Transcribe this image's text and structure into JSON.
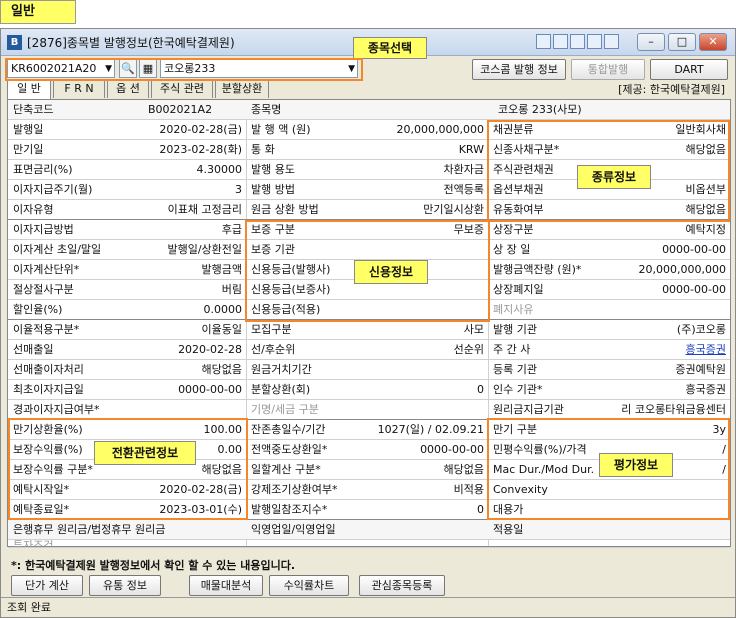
{
  "tag_label": "일반",
  "window": {
    "title": "[2876]종목별 발행정보(한국예탁결제원)",
    "app_icon": "B",
    "min": "–",
    "max": "□",
    "close": "✕"
  },
  "controls": {
    "code_value": "KR6002021A20",
    "search_icon": "🔍",
    "name_value": "코오롱233",
    "buttons": {
      "kosdaq": "코스콤 발행 정보",
      "integrated": "통합발행",
      "dart": "DART"
    }
  },
  "tabs": [
    {
      "label": "일 반",
      "active": true
    },
    {
      "label": "F R N"
    },
    {
      "label": "옵 션"
    },
    {
      "label": "주식 관련"
    },
    {
      "label": "분할상환"
    }
  ],
  "provider": "[제공: 한국예탁결제원]",
  "header_row": {
    "l1": "단축코드",
    "v1": "B002021A2",
    "l2": "종목명",
    "v2": "코오롱 233(사모)"
  },
  "section1": {
    "left": [
      [
        "발행일",
        "2020-02-28(금)"
      ],
      [
        "만기일",
        "2023-02-28(화)"
      ],
      [
        "표면금리(%)",
        "4.30000"
      ],
      [
        "이자지급주기(월)",
        "3"
      ],
      [
        "이자유형",
        "이표채 고정금리"
      ]
    ],
    "mid": [
      [
        "발 행 액 (원)",
        "20,000,000,000"
      ],
      [
        "통 화",
        "KRW"
      ],
      [
        "발행 용도",
        "차환자금"
      ],
      [
        "발행 방법",
        "전액등록"
      ],
      [
        "원금 상환 방법",
        "만기일시상환"
      ]
    ],
    "right": [
      [
        "채권분류",
        "일반회사채"
      ],
      [
        "신종사채구분*",
        "해당없음"
      ],
      [
        "주식관련채권",
        ""
      ],
      [
        "옵션부채권",
        "비옵션부"
      ],
      [
        "유동화여부",
        "해당없음"
      ]
    ]
  },
  "section2": {
    "left": [
      [
        "이자지급방법",
        "후급"
      ],
      [
        "이자계산 초일/말일",
        "발행일/상환전일"
      ],
      [
        "이자계산단위*",
        "발행금액"
      ],
      [
        "절상절사구분",
        "버림"
      ],
      [
        "할인율(%)",
        "0.0000"
      ]
    ],
    "mid": [
      [
        "보증 구분",
        "무보증"
      ],
      [
        "보증 기관",
        ""
      ],
      [
        "신용등급(발행사)",
        ""
      ],
      [
        "신용등급(보증사)",
        ""
      ],
      [
        "신용등급(적용)",
        ""
      ]
    ],
    "right": [
      [
        "상장구분",
        "예탁지정"
      ],
      [
        "상 장 일",
        "0000-00-00"
      ],
      [
        "발행금액잔량 (원)*",
        "20,000,000,000"
      ],
      [
        "상장폐지일",
        "0000-00-00"
      ],
      [
        "폐지사유",
        ""
      ]
    ]
  },
  "section3": {
    "left": [
      [
        "이율적용구분*",
        "이율동일"
      ],
      [
        "선매출일",
        "2020-02-28"
      ],
      [
        "선매출이자처리",
        "해당없음"
      ],
      [
        "최초이자지급일",
        "0000-00-00"
      ],
      [
        "경과이자지급여부*",
        ""
      ]
    ],
    "mid": [
      [
        "모집구분",
        "사모"
      ],
      [
        "선/후순위",
        "선순위"
      ],
      [
        "원금거치기간",
        ""
      ],
      [
        "분할상환(회)",
        "0"
      ],
      [
        "기명/세금 구분",
        ""
      ]
    ],
    "right": [
      [
        "발행 기관",
        "(주)코오롱"
      ],
      [
        "주 간 사",
        "흥국증권"
      ],
      [
        "등록 기관",
        "증권예탁원"
      ],
      [
        "인수 기관*",
        "흥국증권"
      ],
      [
        "원리금지급기관",
        "리 코오롱타워금융센터"
      ]
    ]
  },
  "section4": {
    "left": [
      [
        "만기상환율(%)",
        "100.00"
      ],
      [
        "보장수익률(%)",
        "0.00"
      ],
      [
        "보장수익률 구분*",
        "해당없음"
      ],
      [
        "예탁시작일*",
        "2020-02-28(금)"
      ],
      [
        "예탁종료일*",
        "2023-03-01(수)"
      ]
    ],
    "mid": [
      [
        "잔존총일수/기간",
        "1027(일) / 02.09.21"
      ],
      [
        "전액중도상환일*",
        "0000-00-00"
      ],
      [
        "일할계산 구분*",
        "해당없음"
      ],
      [
        "강제조기상환여부*",
        "비적용"
      ],
      [
        "발행일참조지수*",
        "0"
      ]
    ],
    "right": [
      [
        "만기 구분",
        "3y"
      ],
      [
        "민평수익률(%)/가격",
        "/"
      ],
      [
        "Mac Dur./Mod Dur.",
        "/"
      ],
      [
        "Convexity",
        ""
      ],
      [
        "대용가",
        ""
      ]
    ]
  },
  "bottom_rows": [
    [
      "은행휴무 원리금/법정휴무 원리금",
      "익영업일/익영업일",
      "적용일",
      ""
    ],
    [
      "투자조건",
      "",
      "",
      ""
    ]
  ],
  "callouts": {
    "select": "종목선택",
    "type": "종류정보",
    "credit": "신용정보",
    "convert": "전환관련정보",
    "eval": "평가정보"
  },
  "note": "*: 한국예탁결제원 발행정보에서 확인 할 수 있는 내용입니다.",
  "bottom_buttons": [
    "단가 계산",
    "유통 정보",
    "매물대분석",
    "수익률차트",
    "관심종목등록"
  ],
  "status": "조회 완료"
}
